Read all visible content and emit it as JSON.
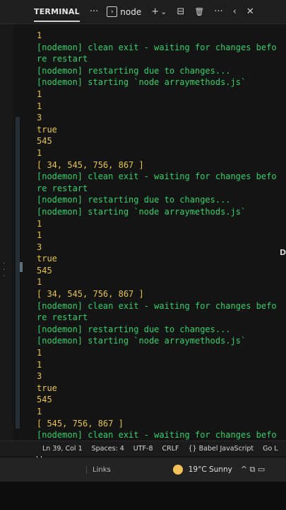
{
  "panel": {
    "tab_label": "TERMINAL",
    "more_glyph": "···",
    "terminal_icon_glyph": "›",
    "terminal_name": "node",
    "add_glyph": "+",
    "dropdown_glyph": "⌄",
    "split_glyph": "⊟",
    "trash_glyph": "🗑",
    "overflow_glyph": "···",
    "back_glyph": "‹",
    "close_glyph": "✕"
  },
  "terminal": {
    "lines": [
      {
        "text": "1",
        "kind": "val"
      },
      {
        "text": "[nodemon] clean exit - waiting for changes before restart",
        "kind": "nodemon"
      },
      {
        "text": "[nodemon] restarting due to changes...",
        "kind": "nodemon"
      },
      {
        "text": "[nodemon] starting `node arraymethods.js`",
        "kind": "nodemon"
      },
      {
        "text": "1",
        "kind": "val"
      },
      {
        "text": "1",
        "kind": "val"
      },
      {
        "text": "3",
        "kind": "val"
      },
      {
        "text": "true",
        "kind": "val"
      },
      {
        "text": "545",
        "kind": "val"
      },
      {
        "text": "1",
        "kind": "val"
      },
      {
        "text": "[ 34, 545, 756, 867 ]",
        "kind": "val"
      },
      {
        "text": "[nodemon] clean exit - waiting for changes before restart",
        "kind": "nodemon"
      },
      {
        "text": "[nodemon] restarting due to changes...",
        "kind": "nodemon"
      },
      {
        "text": "[nodemon] starting `node arraymethods.js`",
        "kind": "nodemon"
      },
      {
        "text": "1",
        "kind": "val"
      },
      {
        "text": "1",
        "kind": "val"
      },
      {
        "text": "3",
        "kind": "val"
      },
      {
        "text": "true",
        "kind": "val"
      },
      {
        "text": "545",
        "kind": "val"
      },
      {
        "text": "1",
        "kind": "val"
      },
      {
        "text": "[ 34, 545, 756, 867 ]",
        "kind": "val"
      },
      {
        "text": "[nodemon] clean exit - waiting for changes before restart",
        "kind": "nodemon"
      },
      {
        "text": "[nodemon] restarting due to changes...",
        "kind": "nodemon"
      },
      {
        "text": "[nodemon] starting `node arraymethods.js`",
        "kind": "nodemon"
      },
      {
        "text": "1",
        "kind": "val"
      },
      {
        "text": "1",
        "kind": "val"
      },
      {
        "text": "3",
        "kind": "val"
      },
      {
        "text": "true",
        "kind": "val"
      },
      {
        "text": "545",
        "kind": "val"
      },
      {
        "text": "1",
        "kind": "val"
      },
      {
        "text": "[ 545, 756, 867 ]",
        "kind": "val"
      },
      {
        "text": "[nodemon] clean exit - waiting for changes before restart",
        "kind": "nodemon"
      }
    ]
  },
  "statusbar": {
    "position": "Ln 39, Col 1",
    "spaces": "Spaces: 4",
    "encoding": "UTF-8",
    "eol": "CRLF",
    "language": "{} Babel JavaScript",
    "golive": "Go L"
  },
  "taskbar": {
    "links": "Links",
    "weather": "19°C  Sunny",
    "tray_glyphs": "^  ⧉  ▭"
  },
  "edge_label": "D",
  "colors": {
    "nodemon_green": "#2ed16b",
    "output_yellow": "#e8c43a",
    "background": "#141414"
  }
}
